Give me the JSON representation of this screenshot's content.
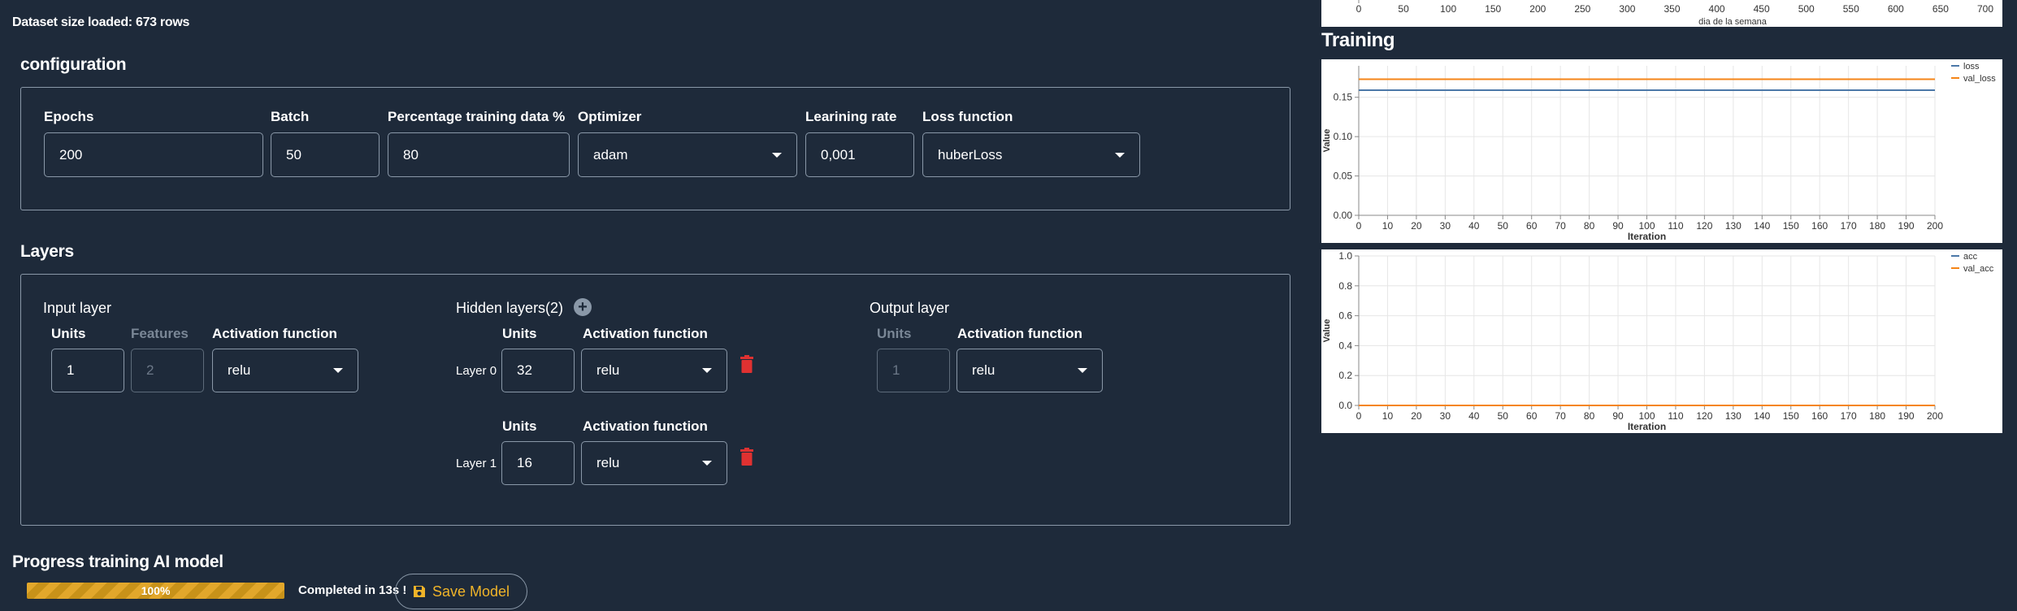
{
  "dataset_info": "Dataset size loaded: 673 rows",
  "config": {
    "title": "configuration",
    "epochs": {
      "label": "Epochs",
      "value": "200"
    },
    "batch": {
      "label": "Batch",
      "value": "50"
    },
    "pct": {
      "label": "Percentage training data %",
      "value": "80"
    },
    "optimizer": {
      "label": "Optimizer",
      "value": "adam"
    },
    "lr": {
      "label": "Learining rate",
      "value": "0,001"
    },
    "loss": {
      "label": "Loss function",
      "value": "huberLoss"
    }
  },
  "layers": {
    "title": "Layers",
    "input": {
      "title": "Input layer",
      "units_label": "Units",
      "units_value": "1",
      "features_label": "Features",
      "features_value": "2",
      "activation_label": "Activation function",
      "activation_value": "relu"
    },
    "hidden": {
      "title": "Hidden layers(2)",
      "rows": [
        {
          "name": "Layer 0",
          "units_label": "Units",
          "units_value": "32",
          "activation_label": "Activation function",
          "activation_value": "relu"
        },
        {
          "name": "Layer 1",
          "units_label": "Units",
          "units_value": "16",
          "activation_label": "Activation function",
          "activation_value": "relu"
        }
      ]
    },
    "output": {
      "title": "Output layer",
      "units_label": "Units",
      "units_value": "1",
      "activation_label": "Activation function",
      "activation_value": "relu"
    }
  },
  "progress": {
    "title": "Progress training AI model",
    "percent": 100,
    "percent_label": "100%",
    "completed": "Completed in 13s !",
    "save_label": "Save Model"
  },
  "colors": {
    "background": "#1e2a3a",
    "accent": "#f0b429",
    "trash": "#e03131",
    "series_blue": "#4c78a8",
    "series_orange": "#f58518"
  },
  "training_title": "Training",
  "chart_data": [
    {
      "type": "line",
      "title": "",
      "xlabel": "dia de la semana",
      "ylabel": "",
      "xticks": [
        "0",
        "50",
        "100",
        "150",
        "200",
        "250",
        "300",
        "350",
        "400",
        "450",
        "500",
        "550",
        "600",
        "650",
        "700"
      ],
      "xlim": [
        0,
        710
      ],
      "note": "top chart partially cropped; only x-axis visible"
    },
    {
      "type": "line",
      "xlabel": "Iteration",
      "ylabel": "Value",
      "xlim": [
        0,
        200
      ],
      "ylim": [
        0,
        0.19
      ],
      "xticks": [
        "0",
        "10",
        "20",
        "30",
        "40",
        "50",
        "60",
        "70",
        "80",
        "90",
        "100",
        "110",
        "120",
        "130",
        "140",
        "150",
        "160",
        "170",
        "180",
        "190",
        "200"
      ],
      "yticks": [
        "0.00",
        "0.05",
        "0.10",
        "0.15"
      ],
      "series": [
        {
          "name": "loss",
          "color": "#4c78a8",
          "x": [
            0,
            200
          ],
          "values": [
            0.159,
            0.159
          ]
        },
        {
          "name": "val_loss",
          "color": "#f58518",
          "x": [
            0,
            200
          ],
          "values": [
            0.173,
            0.173
          ]
        }
      ],
      "legend": "top-right",
      "grid": true
    },
    {
      "type": "line",
      "xlabel": "Iteration",
      "ylabel": "Value",
      "xlim": [
        0,
        200
      ],
      "ylim": [
        0,
        1.0
      ],
      "xticks": [
        "0",
        "10",
        "20",
        "30",
        "40",
        "50",
        "60",
        "70",
        "80",
        "90",
        "100",
        "110",
        "120",
        "130",
        "140",
        "150",
        "160",
        "170",
        "180",
        "190",
        "200"
      ],
      "yticks": [
        "0.0",
        "0.2",
        "0.4",
        "0.6",
        "0.8",
        "1.0"
      ],
      "series": [
        {
          "name": "acc",
          "color": "#4c78a8",
          "x": [
            0,
            200
          ],
          "values": [
            0,
            0
          ]
        },
        {
          "name": "val_acc",
          "color": "#f58518",
          "x": [
            0,
            200
          ],
          "values": [
            0,
            0
          ]
        }
      ],
      "legend": "top-right",
      "grid": true
    }
  ]
}
